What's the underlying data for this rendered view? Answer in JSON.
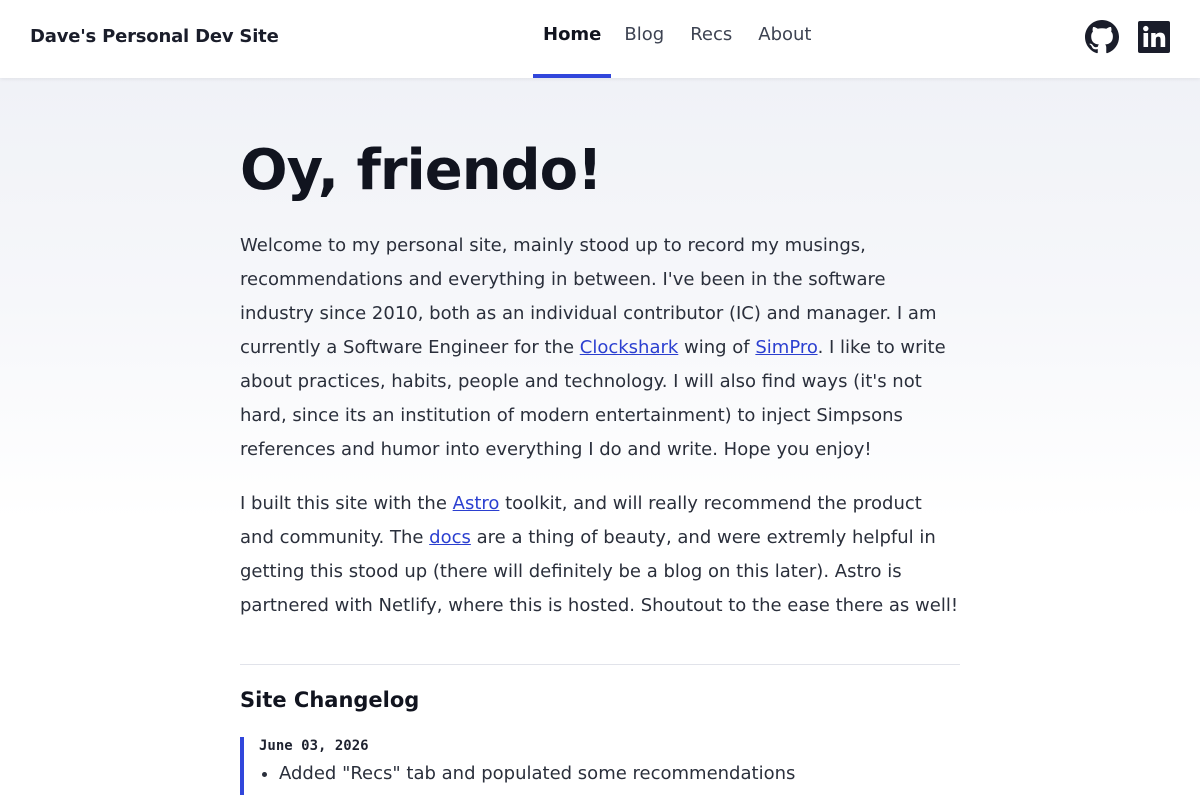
{
  "header": {
    "site_title": "Dave's Personal Dev Site",
    "nav": [
      {
        "label": "Home",
        "active": true
      },
      {
        "label": "Blog",
        "active": false
      },
      {
        "label": "Recs",
        "active": false
      },
      {
        "label": "About",
        "active": false
      }
    ],
    "social": [
      {
        "icon": "github-icon"
      },
      {
        "icon": "linkedin-icon"
      }
    ]
  },
  "main": {
    "heading": "Oy, friendo!",
    "intro": {
      "t1": "Welcome to my personal site, mainly stood up to record my musings, recommendations and everything in between. I've been in the software industry since 2010, both as an individual contributor (IC) and manager. I am currently a Software Engineer for the ",
      "link1": "Clockshark",
      "t2": " wing of ",
      "link2": "SimPro",
      "t3": ". I like to write about practices, habits, people and technology. I will also find ways (it's not hard, since its an institution of modern entertainment) to inject Simpsons references and humor into everything I do and write. Hope you enjoy!"
    },
    "built": {
      "t1": "I built this site with the ",
      "link1": "Astro",
      "t2": " toolkit, and will really recommend the product and community. The ",
      "link2": "docs",
      "t3": " are a thing of beauty, and were extremly helpful in getting this stood up (there will definitely be a blog on this later). Astro is partnered with Netlify, where this is hosted. Shoutout to the ease there as well!"
    },
    "changelog": {
      "title": "Site Changelog",
      "entries": [
        {
          "date": "June 03, 2026",
          "items": [
            "Added \"Recs\" tab and populated some recommendations"
          ]
        }
      ]
    }
  },
  "colors": {
    "accent": "#3146db",
    "link": "#2b3fd0",
    "text": "#2a2f3b",
    "heading": "#11141f"
  }
}
